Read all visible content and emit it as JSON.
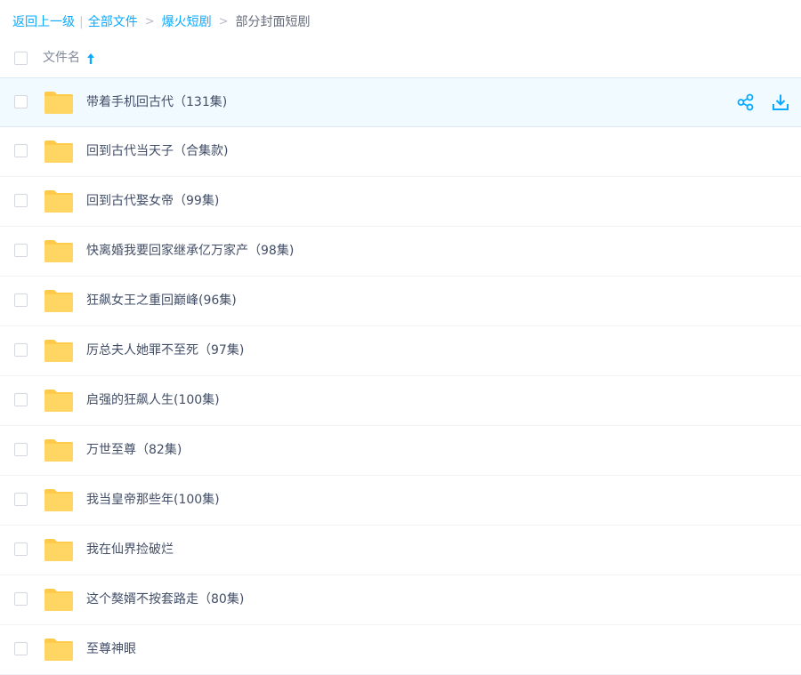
{
  "breadcrumb": {
    "back": "返回上一级",
    "separator": "|",
    "all_files": "全部文件",
    "arrow": ">",
    "level1": "爆火短剧",
    "current": "部分封面短剧"
  },
  "header": {
    "column_label": "文件名",
    "sort_icon": "arrow-up-icon"
  },
  "colors": {
    "accent": "#09aaff",
    "folder": "#ffd664",
    "folder_tab": "#ffc94a",
    "hover_row": "#f1faff"
  },
  "files": [
    {
      "name": "带着手机回古代（131集)",
      "icon": "folder-icon"
    },
    {
      "name": "回到古代当天子（合集款)",
      "icon": "folder-icon"
    },
    {
      "name": "回到古代娶女帝（99集)",
      "icon": "folder-icon"
    },
    {
      "name": "快离婚我要回家继承亿万家产（98集)",
      "icon": "folder-icon"
    },
    {
      "name": "狂飙女王之重回巅峰(96集)",
      "icon": "folder-icon"
    },
    {
      "name": "厉总夫人她罪不至死（97集)",
      "icon": "folder-icon"
    },
    {
      "name": "启强的狂飙人生(100集)",
      "icon": "folder-icon"
    },
    {
      "name": "万世至尊（82集)",
      "icon": "folder-icon"
    },
    {
      "name": "我当皇帝那些年(100集)",
      "icon": "folder-icon"
    },
    {
      "name": "我在仙界捡破烂",
      "icon": "folder-icon"
    },
    {
      "name": "这个獒婿不按套路走（80集)",
      "icon": "folder-icon"
    },
    {
      "name": "至尊神眼",
      "icon": "folder-icon"
    }
  ],
  "row_actions": {
    "share_icon": "share-icon",
    "download_icon": "download-icon"
  }
}
